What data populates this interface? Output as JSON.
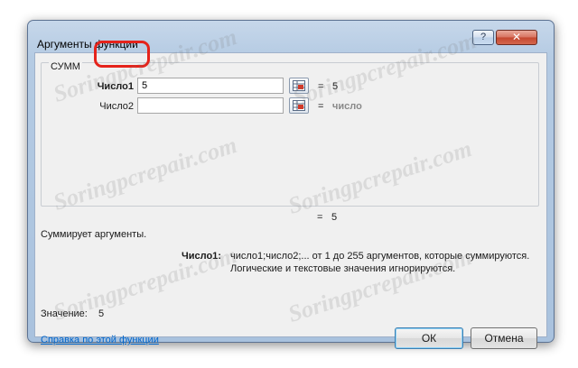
{
  "window": {
    "title": "Аргументы функции",
    "help_glyph": "?",
    "close_glyph": "✕"
  },
  "function": {
    "name": "СУММ"
  },
  "args": [
    {
      "label": "Число1",
      "value": "5",
      "result": "5"
    },
    {
      "label": "Число2",
      "value": "",
      "result": "число"
    }
  ],
  "equals_sign": "=",
  "total_result": "5",
  "description": "Суммирует аргументы.",
  "detail": {
    "label": "Число1:",
    "line1": "число1;число2;... от 1 до 255 аргументов, которые суммируются.",
    "line2": "Логические и текстовые значения игнорируются."
  },
  "value": {
    "label": "Значение:",
    "amount": "5"
  },
  "help_link": "Справка по этой функции",
  "buttons": {
    "ok": "ОК",
    "cancel": "Отмена"
  },
  "watermark": "Soringpcrepair.com",
  "colors": {
    "highlight": "#e5231b",
    "link": "#0066cc"
  },
  "icons": {
    "collapse_button": "range-select-icon",
    "help": "question-mark",
    "close": "x-mark"
  }
}
